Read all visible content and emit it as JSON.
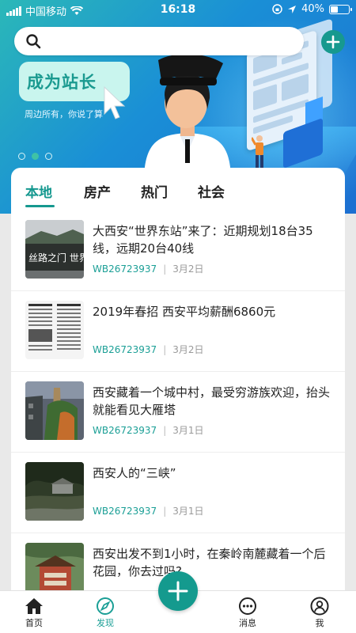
{
  "status_bar": {
    "carrier": "中国移动",
    "time": "16:18",
    "battery": "40%",
    "battery_level": 0.4
  },
  "search": {
    "placeholder": ""
  },
  "banner": {
    "promo_title": "成为站长",
    "promo_subtitle": "周边所有，你说了算",
    "carousel_pages": 3,
    "carousel_active": 1
  },
  "tabs": [
    {
      "label": "本地",
      "active": true
    },
    {
      "label": "房产",
      "active": false
    },
    {
      "label": "热门",
      "active": false
    },
    {
      "label": "社会",
      "active": false
    }
  ],
  "articles": [
    {
      "title": "大西安“世界东站”来了：近期规划18台35线，远期20台40线",
      "source": "WB26723937",
      "date": "3月2日",
      "image": "silk-road-gate-photo"
    },
    {
      "title": "2019年春招 西安平均薪酬6860元",
      "source": "WB26723937",
      "date": "3月2日",
      "image": "newspaper-photo"
    },
    {
      "title": "西安藏着一个城中村，最受穷游族欢迎，抬头就能看见大雁塔",
      "source": "WB26723937",
      "date": "3月1日",
      "image": "village-pagoda-photo"
    },
    {
      "title": "西安人的“三峡”",
      "source": "WB26723937",
      "date": "3月1日",
      "image": "mountain-house-photo"
    },
    {
      "title": "西安出发不到1小时，在秦岭南麓藏着一个后花园，你去过吗?",
      "source": "",
      "date": "",
      "image": "temple-garden-photo"
    }
  ],
  "nav": [
    {
      "label": "首页",
      "icon": "home-icon",
      "active": false
    },
    {
      "label": "发现",
      "icon": "compass-icon",
      "active": true
    },
    {
      "label": "",
      "icon": "plus-icon",
      "active": false
    },
    {
      "label": "消息",
      "icon": "message-icon",
      "active": false
    },
    {
      "label": "我",
      "icon": "profile-icon",
      "active": false
    }
  ],
  "colors": {
    "accent": "#15988f",
    "banner_start": "#2bb8b8",
    "banner_end": "#1c6fd1",
    "promo_bg": "#c9f5ee"
  }
}
